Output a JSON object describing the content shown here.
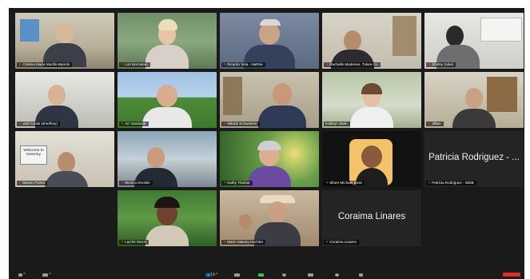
{
  "participants": [
    {
      "name": "Cristina Maria Murillo-Barrick",
      "muted": true
    },
    {
      "name": "Lori Bernstein",
      "muted": true
    },
    {
      "name": "Ricardo Vela - HaRrie",
      "muted": true
    },
    {
      "name": "Rachelle Madenes, Tulare Co",
      "muted": true
    },
    {
      "name": "Shirley Soleri",
      "muted": true
    },
    {
      "name": "Jodi Azulai (she/they)",
      "muted": true
    },
    {
      "name": "Art Vandazar",
      "muted": true
    },
    {
      "name": "Nikolai Schweitzer",
      "muted": true
    },
    {
      "name": "Kathryn Stein",
      "muted": false
    },
    {
      "name": "Jillian",
      "muted": true
    },
    {
      "name": "Marvin Flores",
      "muted": true
    },
    {
      "name": "Monica Dreckle",
      "muted": true
    },
    {
      "name": "Kathy Tfankar",
      "muted": true
    },
    {
      "name": "Sibert Michael Bose",
      "muted": true
    },
    {
      "name": "Patricia Rodriguez - WDB",
      "muted": true,
      "display_text": "Patricia Rodriguez - ..."
    },
    {
      "name": "LaChé Mozzi",
      "muted": true
    },
    {
      "name": "Mario Mainey Hechter",
      "muted": true
    },
    {
      "name": "Coraima Linares",
      "muted": true,
      "display_text": "Coraima Linares"
    }
  ],
  "sign_text": "Welcome to Kearney",
  "toolbar": {
    "participants_count": "19"
  },
  "colors": {
    "window_bg": "#1a1a1a",
    "active_speaker": "#3fc93f",
    "mute_red": "#ff3b3b"
  }
}
